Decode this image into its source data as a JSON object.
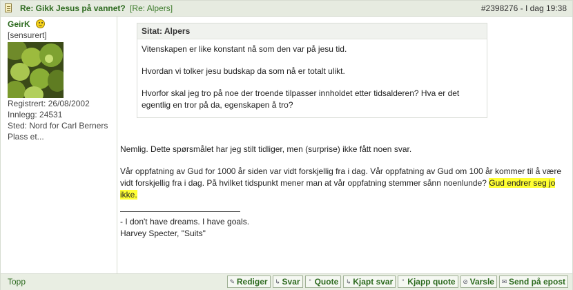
{
  "post": {
    "title": "Re: Gikk Jesus på vannet?",
    "reply_to": "[Re: Alpers]",
    "post_id": "#2398276",
    "separator": " - ",
    "time": "I dag 19:38"
  },
  "author": {
    "name": "GeirK",
    "role": "[sensurert]",
    "registered": "Registrert: 26/08/2002",
    "posts": "Innlegg: 24531",
    "location": "Sted: Nord for Carl Berners",
    "location_more": "Plass et..."
  },
  "quote": {
    "header": "Sitat: Alpers",
    "lines": [
      "Vitenskapen er like konstant nå som den var på jesu tid.",
      "Hvordan vi tolker jesu budskap da som nå er totalt ulikt.",
      "Hvorfor skal jeg tro på noe der troende tilpasser innholdet etter tidsalderen? Hva er det egentlig en tror på da, egenskapen å tro?"
    ]
  },
  "body": {
    "para1": "Nemlig. Dette spørsmålet har jeg stilt tidliger, men (surprise) ikke fått noen svar.",
    "para2": "Vår oppfatning av Gud for 1000 år siden var vidt forskjellig fra i dag. Vår oppfatning av Gud om 100 år kommer til å være vidt forskjellig fra i dag. På hvilket tidspunkt mener man at vår oppfatning stemmer sånn noenlunde? ",
    "para2_highlight": "Gud endrer seg jo ikke.",
    "highlight_color": "#ffff33",
    "sig1": "- I don't have dreams. I have goals.",
    "sig2": "Harvey Specter, \"Suits\""
  },
  "footer": {
    "top_link": "Topp",
    "buttons": {
      "edit": "Rediger",
      "reply": "Svar",
      "quote": "Quote",
      "quick_reply": "Kjapt svar",
      "quick_quote": "Kjapp quote",
      "report": "Varsle",
      "email": "Send på epost"
    }
  },
  "colors": {
    "header_bg": "#e6ebe0",
    "link_green": "#2d6a1f"
  }
}
